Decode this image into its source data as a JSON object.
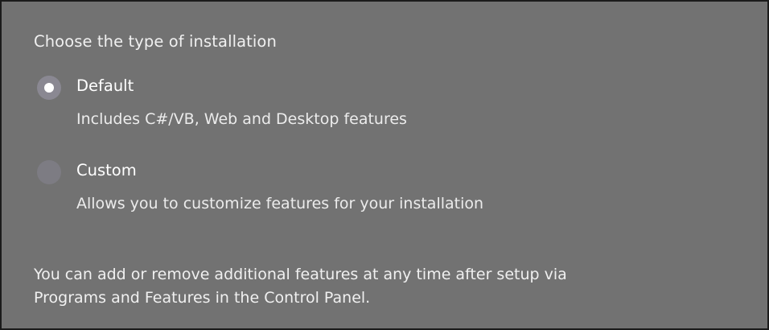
{
  "heading": "Choose the type of installation",
  "options": [
    {
      "label": "Default",
      "description": "Includes C#/VB, Web and Desktop features",
      "selected": true
    },
    {
      "label": "Custom",
      "description": "Allows you to customize features for your installation",
      "selected": false
    }
  ],
  "footer": {
    "line1": "You can add or remove additional features at any time after setup via",
    "line2": "Programs and Features in the Control Panel."
  },
  "colors": {
    "panel_background": "#727272",
    "border": "#1b1b1b",
    "text": "#f2f2f2",
    "radio_fill": "#8a8892",
    "radio_dot": "#ffffff"
  }
}
